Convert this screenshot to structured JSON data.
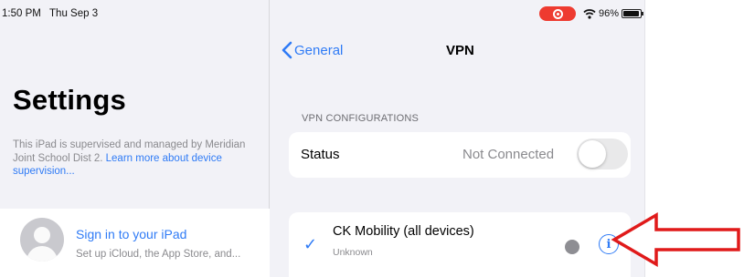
{
  "status_bar": {
    "time": "1:50 PM",
    "date": "Thu Sep 3",
    "battery_percent": "96%",
    "battery_level": 0.96,
    "recording_color": "#ee3b30"
  },
  "sidebar": {
    "title": "Settings",
    "supervision_text": "This iPad is supervised and managed by Meridian Joint School Dist 2.",
    "learn_more_link": "Learn more about device supervision...",
    "sign_in": {
      "title": "Sign in to your iPad",
      "subtitle": "Set up iCloud, the App Store, and..."
    }
  },
  "detail": {
    "back_label": "General",
    "nav_title": "VPN",
    "section_header": "VPN CONFIGURATIONS",
    "status_row": {
      "label": "Status",
      "value": "Not Connected",
      "toggle_on": false
    },
    "vpn_item": {
      "name": "CK Mobility (all devices)",
      "subtitle": "Unknown",
      "selected": true,
      "check_glyph": "✓",
      "info_glyph": "i"
    }
  },
  "colors": {
    "accent": "#2f7bf6",
    "annotation_arrow": "#e01a1a",
    "background": "#f2f2f7"
  },
  "icons": [
    "record-icon",
    "wifi-icon",
    "battery-icon",
    "avatar-icon",
    "chevron-left-icon",
    "checkmark-icon",
    "status-dot-icon",
    "info-icon",
    "arrow-annotation-icon"
  ]
}
